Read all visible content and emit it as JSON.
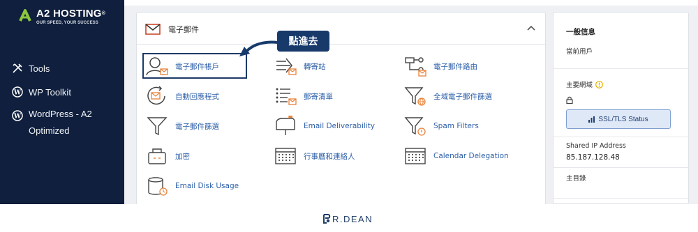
{
  "sidebar": {
    "logo_name": "A2 HOSTING",
    "logo_reg": "®",
    "logo_tag": "OUR SPEED, YOUR SUCCESS",
    "items": [
      {
        "label": "Tools"
      },
      {
        "label": "WP Toolkit"
      },
      {
        "label": "WordPress - A2 Optimized"
      }
    ]
  },
  "email_section": {
    "title": "電子郵件",
    "items": [
      {
        "label": "電子郵件帳戶",
        "icon": "user-mail-icon"
      },
      {
        "label": "轉寄站",
        "icon": "forward-icon"
      },
      {
        "label": "電子郵件路由",
        "icon": "routing-icon"
      },
      {
        "label": "自動回應程式",
        "icon": "autoresponder-icon"
      },
      {
        "label": "郵寄清單",
        "icon": "mailing-list-icon"
      },
      {
        "label": "全域電子郵件篩選",
        "icon": "global-filter-icon"
      },
      {
        "label": "電子郵件篩選",
        "icon": "filter-icon"
      },
      {
        "label": "Email Deliverability",
        "icon": "mailbox-icon"
      },
      {
        "label": "Spam Filters",
        "icon": "spam-filter-icon"
      },
      {
        "label": "加密",
        "icon": "encryption-icon"
      },
      {
        "label": "行事曆和連絡人",
        "icon": "calendar-icon"
      },
      {
        "label": "Calendar Delegation",
        "icon": "calendar-delegation-icon"
      },
      {
        "label": "Email Disk Usage",
        "icon": "disk-usage-icon"
      }
    ]
  },
  "callout": {
    "text": "點進去"
  },
  "general_info": {
    "title": "一般信息",
    "current_user_label": "當前用戶",
    "primary_domain_label": "主要網域",
    "ssl_button": "SSL/TLS Status",
    "shared_ip_label": "Shared IP Address",
    "shared_ip_value": "85.187.128.48",
    "home_dir_label": "主目錄"
  },
  "footer": {
    "brand": "R.DEAN"
  },
  "colors": {
    "sidebar": "#0f1f3d",
    "link": "#2d5fa8",
    "callout": "#173a6b",
    "accent_orange": "#e8833a"
  }
}
